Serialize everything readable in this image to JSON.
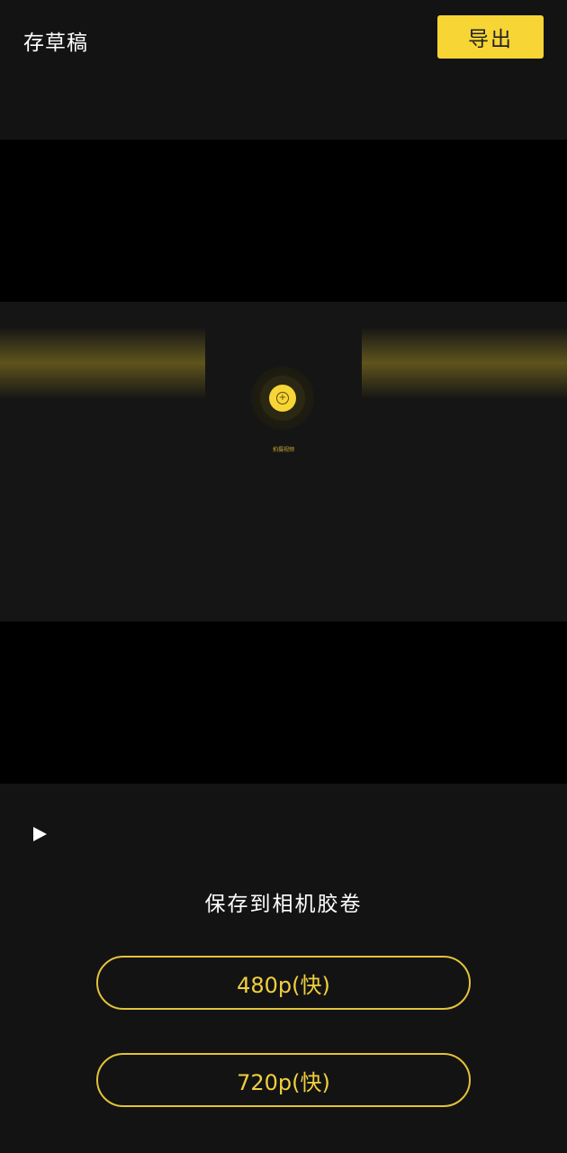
{
  "header": {
    "draft_label": "存草稿",
    "export_label": "导出"
  },
  "preview": {
    "caption": "拍摄视频",
    "record_icon": "plus-icon"
  },
  "player": {
    "play_icon": "play-icon"
  },
  "export_panel": {
    "title": "保存到相机胶卷",
    "options": [
      {
        "label": "480p(快)"
      },
      {
        "label": "720p(快)"
      }
    ]
  },
  "colors": {
    "accent": "#f7d535",
    "background": "#131313",
    "letterbox": "#000000"
  }
}
